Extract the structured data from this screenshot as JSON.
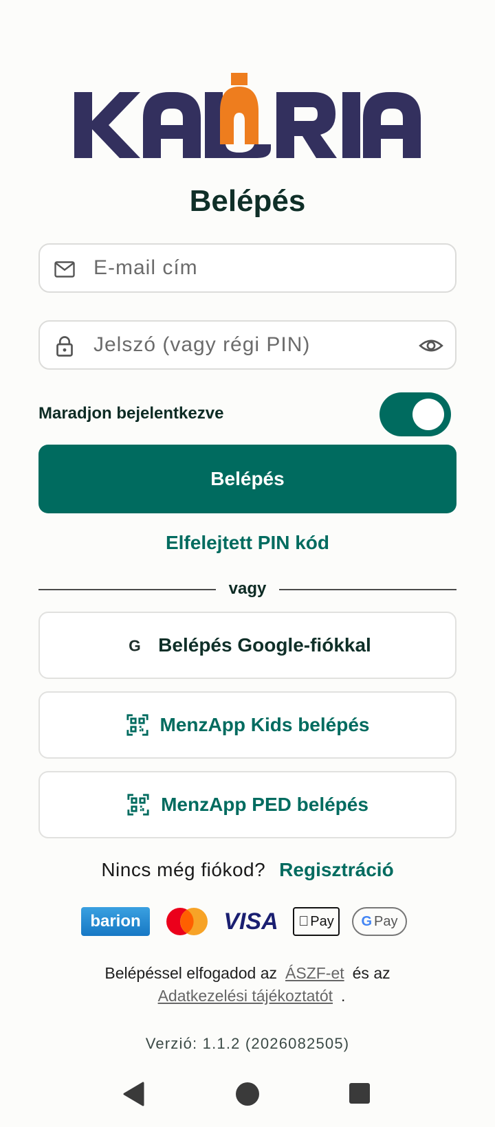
{
  "brand": {
    "logo_text": "KALÓRIA",
    "colors": {
      "navy": "#33305e",
      "orange": "#ee7d1e",
      "teal": "#006b5f"
    }
  },
  "login": {
    "title": "Belépés",
    "email": {
      "placeholder": "E-mail cím",
      "value": "",
      "icon": "mail-icon"
    },
    "password": {
      "placeholder": "Jelszó (vagy régi PIN)",
      "value": "",
      "icon": "lock-icon",
      "toggle_icon": "eye-icon"
    },
    "remember_label": "Maradjon bejelentkezve",
    "remember_on": true,
    "submit_label": "Belépés",
    "forgot_label": "Elfelejtett PIN kód",
    "divider_label": "vagy"
  },
  "alt_logins": [
    {
      "label": "Belépés Google-fiókkal",
      "icon": "google-icon"
    },
    {
      "label": "MenzApp Kids belépés",
      "icon": "qr-scan-icon"
    },
    {
      "label": "MenzApp PED belépés",
      "icon": "qr-scan-icon"
    }
  ],
  "signup": {
    "question": "Nincs még fiókod?",
    "link": "Regisztráció"
  },
  "payments": {
    "barion": "barion",
    "visa": "VISA",
    "apple_pay": "Pay",
    "google_pay": "Pay",
    "google_g": "G"
  },
  "terms": {
    "prefix": "Belépéssel elfogadod az",
    "aszf": "ÁSZF-et",
    "middle": "és az",
    "privacy": "Adatkezelési tájékoztatót",
    "suffix": "."
  },
  "version": "Verzió: 1.1.2 (2026082505)"
}
